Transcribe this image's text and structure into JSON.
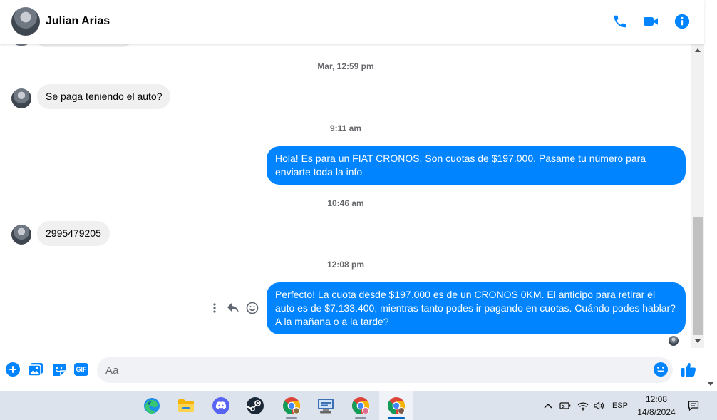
{
  "header": {
    "contact_name": "Julian Arias",
    "icons": [
      "phone-icon",
      "video-camera-icon",
      "info-icon"
    ]
  },
  "conversation": {
    "items": [
      {
        "type": "timestamp",
        "text": "Mar, 12:59 pm"
      },
      {
        "type": "incoming",
        "text": "Se paga teniendo el auto?"
      },
      {
        "type": "timestamp",
        "text": "9:11 am"
      },
      {
        "type": "outgoing",
        "text": "Hola! Es para un FIAT CRONOS. Son cuotas de $197.000. Pasame tu número para enviarte toda la info"
      },
      {
        "type": "timestamp",
        "text": "10:46 am"
      },
      {
        "type": "incoming",
        "text": "2995479205"
      },
      {
        "type": "timestamp",
        "text": "12:08 pm"
      },
      {
        "type": "outgoing",
        "text": "Perfecto! La cuota desde $197.000 es de un CRONOS 0KM. El anticipo para retirar el auto es de $7.133.400, mientras tanto podes ir pagando en cuotas. Cuándo podes hablar? A la mañana o a la tarde?"
      }
    ],
    "message_actions": [
      "more-options-icon",
      "reply-icon",
      "emoji-react-icon"
    ]
  },
  "composer": {
    "placeholder": "Aa",
    "gif_label": "GIF",
    "icons": [
      "plus-icon",
      "image-icon",
      "sticker-icon",
      "gif-icon",
      "emoji-icon",
      "thumbs-up-icon"
    ]
  },
  "taskbar": {
    "apps": [
      "edge-icon",
      "file-explorer-icon",
      "discord-icon",
      "steam-icon",
      "chrome-icon",
      "network-app-icon",
      "chrome-profile-icon",
      "chrome-profile-icon-2"
    ],
    "language": "ESP",
    "time": "12:08",
    "date": "14/8/2024"
  },
  "colors": {
    "accent": "#0084ff",
    "incoming_bubble": "#f0f0f0",
    "outgoing_text": "#ffffff",
    "timestamp_text": "#65676b"
  }
}
